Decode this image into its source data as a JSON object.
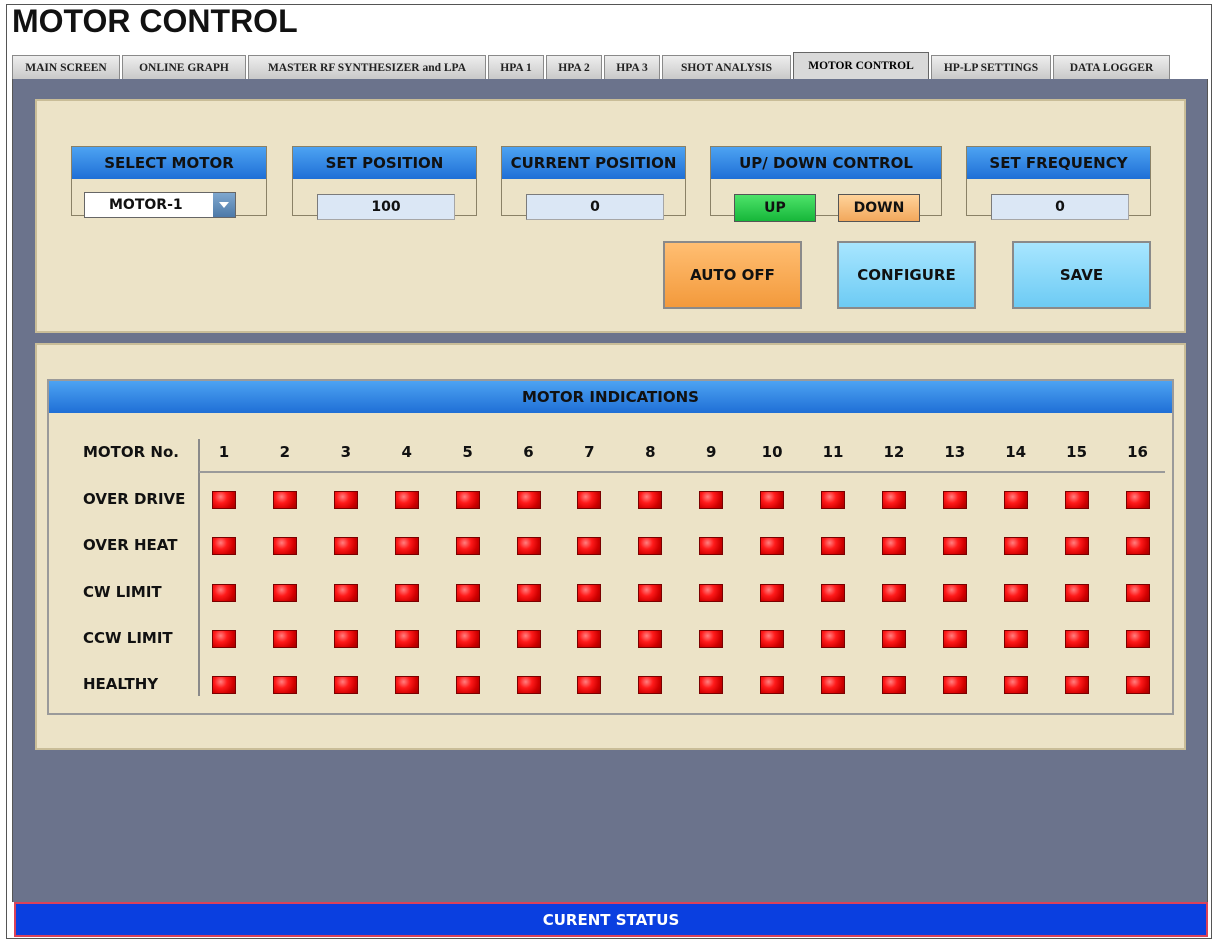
{
  "app_title": "MOTOR CONTROL",
  "tabs": [
    {
      "label": "MAIN SCREEN",
      "active": false
    },
    {
      "label": "ONLINE GRAPH",
      "active": false
    },
    {
      "label": "MASTER RF SYNTHESIZER and LPA",
      "active": false
    },
    {
      "label": "HPA 1",
      "active": false
    },
    {
      "label": "HPA 2",
      "active": false
    },
    {
      "label": "HPA 3",
      "active": false
    },
    {
      "label": "SHOT ANALYSIS",
      "active": false
    },
    {
      "label": "MOTOR CONTROL",
      "active": true
    },
    {
      "label": "HP-LP SETTINGS",
      "active": false
    },
    {
      "label": "DATA LOGGER",
      "active": false
    }
  ],
  "controls": {
    "select_motor": {
      "label": "SELECT MOTOR",
      "value": "MOTOR-1"
    },
    "set_position": {
      "label": "SET POSITION",
      "value": "100"
    },
    "current_position": {
      "label": "CURRENT POSITION",
      "value": "0"
    },
    "updown": {
      "label": "UP/ DOWN CONTROL",
      "up": "UP",
      "down": "DOWN"
    },
    "set_frequency": {
      "label": "SET FREQUENCY",
      "value": "0"
    }
  },
  "buttons": {
    "auto": "AUTO OFF",
    "configure": "CONFIGURE",
    "save": "SAVE"
  },
  "indications": {
    "title": "MOTOR INDICATIONS",
    "motor_no_label": "MOTOR No.",
    "motors": [
      "1",
      "2",
      "3",
      "4",
      "5",
      "6",
      "7",
      "8",
      "9",
      "10",
      "11",
      "12",
      "13",
      "14",
      "15",
      "16"
    ],
    "rows": [
      "OVER DRIVE",
      "OVER HEAT",
      "CW LIMIT",
      "CCW LIMIT",
      "HEALTHY"
    ],
    "led_color": "#ff1a1a",
    "led_state": "off-red"
  },
  "status_bar": "CURENT STATUS"
}
